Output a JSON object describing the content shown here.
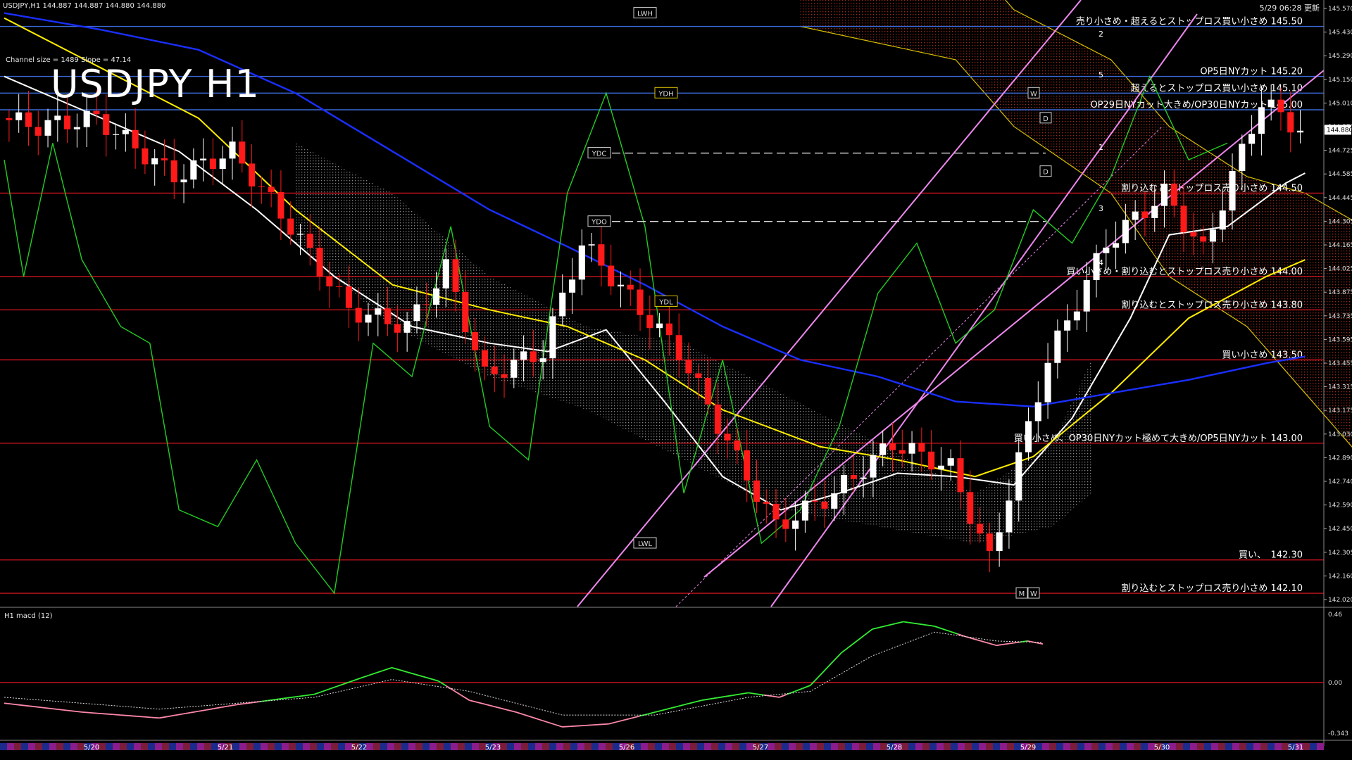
{
  "header": {
    "symbol_line": "USDJPY,H1  144.887 144.887 144.880 144.880",
    "channel_info": "Channel size = 1489 Slope = 47.14",
    "title": "USDJPY H1",
    "timestamp": "5/29 06:28 更新",
    "macd_label": "H1  macd (12)"
  },
  "colors": {
    "background": "#000000",
    "bull_candle": "#ffffff",
    "bear_candle": "#ff1a1a",
    "sma_white": "#ffffff",
    "sma_yellow": "#ffee00",
    "sma_blue": "#1a2fff",
    "chikou_green": "#22cc22",
    "channel_pink": "#ee88ee",
    "level_red": "#c8141e",
    "level_blue": "#3a6ad8",
    "macd_main": "#33ee33",
    "macd_signal": "#dddddd",
    "macd_neg": "#ff88aa"
  },
  "chart_data": [
    {
      "type": "line",
      "title": "USDJPY H1",
      "y_axis": {
        "range": [
          142.02,
          145.65
        ],
        "ticks": [
          "145.570",
          "145.430",
          "145.290",
          "145.150",
          "145.010",
          "144.870",
          "144.725",
          "144.585",
          "144.445",
          "144.305",
          "144.165",
          "144.025",
          "143.875",
          "143.735",
          "143.595",
          "143.455",
          "143.315",
          "143.175",
          "143.030",
          "142.890",
          "142.740",
          "142.590",
          "142.450",
          "142.305",
          "142.160",
          "142.020"
        ],
        "current_price": "144.880"
      },
      "x_axis": {
        "date_labels": [
          "5/20",
          "5/21",
          "5/22",
          "5/23",
          "5/26",
          "5/27",
          "5/28",
          "5/29",
          "5/30",
          "5/31"
        ]
      },
      "grid": false,
      "series": [
        {
          "kind": "ohlc_candles",
          "approx_close_path": [
            [
              0,
              144.95
            ],
            [
              4,
              144.9
            ],
            [
              10,
              144.95
            ],
            [
              18,
              144.6
            ],
            [
              24,
              144.75
            ],
            [
              30,
              144.3
            ],
            [
              36,
              143.8
            ],
            [
              42,
              143.7
            ],
            [
              46,
              144.05
            ],
            [
              50,
              143.4
            ],
            [
              56,
              143.55
            ],
            [
              60,
              144.2
            ],
            [
              66,
              143.8
            ],
            [
              70,
              143.55
            ],
            [
              76,
              142.9
            ],
            [
              80,
              142.5
            ],
            [
              86,
              142.7
            ],
            [
              92,
              143.0
            ],
            [
              98,
              142.85
            ],
            [
              102,
              142.3
            ],
            [
              108,
              143.5
            ],
            [
              114,
              144.2
            ],
            [
              120,
              144.5
            ],
            [
              124,
              144.15
            ],
            [
              130,
              145.05
            ],
            [
              134,
              144.88
            ]
          ]
        },
        {
          "kind": "sma_white",
          "points": [
            [
              0,
              145.2
            ],
            [
              8,
              145.0
            ],
            [
              18,
              144.75
            ],
            [
              26,
              144.4
            ],
            [
              34,
              144.0
            ],
            [
              42,
              143.7
            ],
            [
              50,
              143.6
            ],
            [
              56,
              143.55
            ],
            [
              62,
              143.68
            ],
            [
              68,
              143.25
            ],
            [
              74,
              142.8
            ],
            [
              80,
              142.6
            ],
            [
              86,
              142.7
            ],
            [
              92,
              142.82
            ],
            [
              98,
              142.8
            ],
            [
              104,
              142.75
            ],
            [
              110,
              143.15
            ],
            [
              116,
              143.75
            ],
            [
              120,
              144.25
            ],
            [
              126,
              144.3
            ],
            [
              132,
              144.56
            ],
            [
              134,
              144.62
            ]
          ]
        },
        {
          "kind": "sma_yellow",
          "points": [
            [
              0,
              145.55
            ],
            [
              10,
              145.25
            ],
            [
              20,
              144.95
            ],
            [
              30,
              144.4
            ],
            [
              40,
              143.95
            ],
            [
              50,
              143.8
            ],
            [
              58,
              143.7
            ],
            [
              66,
              143.5
            ],
            [
              74,
              143.2
            ],
            [
              84,
              142.98
            ],
            [
              92,
              142.9
            ],
            [
              100,
              142.8
            ],
            [
              106,
              142.92
            ],
            [
              114,
              143.3
            ],
            [
              122,
              143.75
            ],
            [
              130,
              144.0
            ],
            [
              134,
              144.1
            ]
          ]
        },
        {
          "kind": "sma_blue",
          "points": [
            [
              0,
              145.58
            ],
            [
              10,
              145.48
            ],
            [
              20,
              145.36
            ],
            [
              30,
              145.1
            ],
            [
              40,
              144.75
            ],
            [
              50,
              144.4
            ],
            [
              58,
              144.18
            ],
            [
              66,
              143.95
            ],
            [
              74,
              143.7
            ],
            [
              82,
              143.5
            ],
            [
              90,
              143.4
            ],
            [
              98,
              143.25
            ],
            [
              106,
              143.22
            ],
            [
              114,
              143.3
            ],
            [
              122,
              143.38
            ],
            [
              130,
              143.48
            ],
            [
              134,
              143.52
            ]
          ]
        },
        {
          "kind": "chikou_green",
          "points": [
            [
              0,
              144.7
            ],
            [
              2,
              144.0
            ],
            [
              5,
              144.8
            ],
            [
              8,
              144.1
            ],
            [
              12,
              143.7
            ],
            [
              15,
              143.6
            ],
            [
              18,
              142.6
            ],
            [
              22,
              142.5
            ],
            [
              26,
              142.9
            ],
            [
              30,
              142.4
            ],
            [
              34,
              142.1
            ],
            [
              38,
              143.6
            ],
            [
              42,
              143.4
            ],
            [
              46,
              144.3
            ],
            [
              50,
              143.1
            ],
            [
              54,
              142.9
            ],
            [
              58,
              144.5
            ],
            [
              62,
              145.1
            ],
            [
              66,
              144.3
            ],
            [
              70,
              142.7
            ],
            [
              74,
              143.5
            ],
            [
              78,
              142.4
            ],
            [
              82,
              142.6
            ],
            [
              86,
              143.1
            ],
            [
              90,
              143.9
            ],
            [
              94,
              144.2
            ],
            [
              98,
              143.6
            ],
            [
              102,
              143.8
            ],
            [
              106,
              144.4
            ],
            [
              110,
              144.2
            ],
            [
              114,
              144.6
            ],
            [
              118,
              145.2
            ],
            [
              122,
              144.7
            ],
            [
              126,
              144.8
            ]
          ]
        }
      ],
      "levels": [
        {
          "price": 145.5,
          "label": "売り小さめ・超えるとストップロス買い小さめ 145.50",
          "color": "blue"
        },
        {
          "price": 145.2,
          "label": "OP5日NYカット 145.20",
          "color": "blue"
        },
        {
          "price": 145.1,
          "label": "超えるとストップロス買い小さめ 145.10",
          "color": "blue"
        },
        {
          "price": 145.0,
          "label": "OP29日NYカット大きめ/OP30日NYカット 145.00",
          "color": "blue"
        },
        {
          "price": 144.5,
          "label": "割り込むとストップロス売り小さめ 144.50",
          "color": "red"
        },
        {
          "price": 144.0,
          "label": "買い小さめ・割り込むとストップロス売り小さめ 144.00",
          "color": "red"
        },
        {
          "price": 143.8,
          "label": "割り込むとストップロス売り小さめ 143.80",
          "color": "red"
        },
        {
          "price": 143.5,
          "label": "買い小さめ 143.50",
          "color": "red"
        },
        {
          "price": 143.0,
          "label": "買い小さめ、OP30日NYカット極めて大きめ/OP5日NYカット 143.00",
          "color": "red"
        },
        {
          "price": 142.3,
          "label": "買い、　142.30",
          "color": "red"
        },
        {
          "price": 142.1,
          "label": "割り込むとストップロス売り小さめ 142.10",
          "color": "red"
        }
      ],
      "reference_tags": [
        {
          "text": "LWH",
          "price": 145.58
        },
        {
          "text": "YDH",
          "price": 145.1
        },
        {
          "text": "YDC",
          "price": 144.74
        },
        {
          "text": "YDO",
          "price": 144.33
        },
        {
          "text": "YDL",
          "price": 143.85
        },
        {
          "text": "LWL",
          "price": 142.4
        },
        {
          "text": "W",
          "price": 145.1
        },
        {
          "text": "D",
          "price": 144.95
        },
        {
          "text": "D",
          "price": 144.63
        },
        {
          "text": "M",
          "price": 142.1
        },
        {
          "text": "W",
          "price": 142.1
        }
      ],
      "projection_labels": [
        "2",
        "5",
        "1",
        "3",
        "4"
      ]
    },
    {
      "type": "line",
      "title": "H1  macd (12)",
      "y_axis": {
        "range": [
          -0.343,
          0.46
        ],
        "ticks": [
          "0.46",
          "0.00",
          "-0.343"
        ]
      },
      "series": [
        {
          "name": "macd",
          "points": [
            [
              0,
              -0.14
            ],
            [
              10,
              -0.2
            ],
            [
              20,
              -0.24
            ],
            [
              30,
              -0.15
            ],
            [
              40,
              -0.08
            ],
            [
              46,
              0.03
            ],
            [
              50,
              0.1
            ],
            [
              56,
              0.01
            ],
            [
              60,
              -0.12
            ],
            [
              66,
              -0.2
            ],
            [
              72,
              -0.3
            ],
            [
              78,
              -0.28
            ],
            [
              84,
              -0.2
            ],
            [
              90,
              -0.12
            ],
            [
              96,
              -0.07
            ],
            [
              100,
              -0.1
            ],
            [
              104,
              -0.02
            ],
            [
              108,
              0.2
            ],
            [
              112,
              0.36
            ],
            [
              116,
              0.41
            ],
            [
              120,
              0.38
            ],
            [
              124,
              0.31
            ],
            [
              128,
              0.25
            ],
            [
              132,
              0.28
            ],
            [
              134,
              0.26
            ]
          ]
        },
        {
          "name": "signal",
          "points": [
            [
              0,
              -0.1
            ],
            [
              20,
              -0.18
            ],
            [
              40,
              -0.1
            ],
            [
              50,
              0.02
            ],
            [
              60,
              -0.06
            ],
            [
              72,
              -0.22
            ],
            [
              84,
              -0.22
            ],
            [
              96,
              -0.1
            ],
            [
              104,
              -0.06
            ],
            [
              112,
              0.18
            ],
            [
              120,
              0.34
            ],
            [
              128,
              0.28
            ],
            [
              134,
              0.27
            ]
          ]
        }
      ]
    }
  ]
}
